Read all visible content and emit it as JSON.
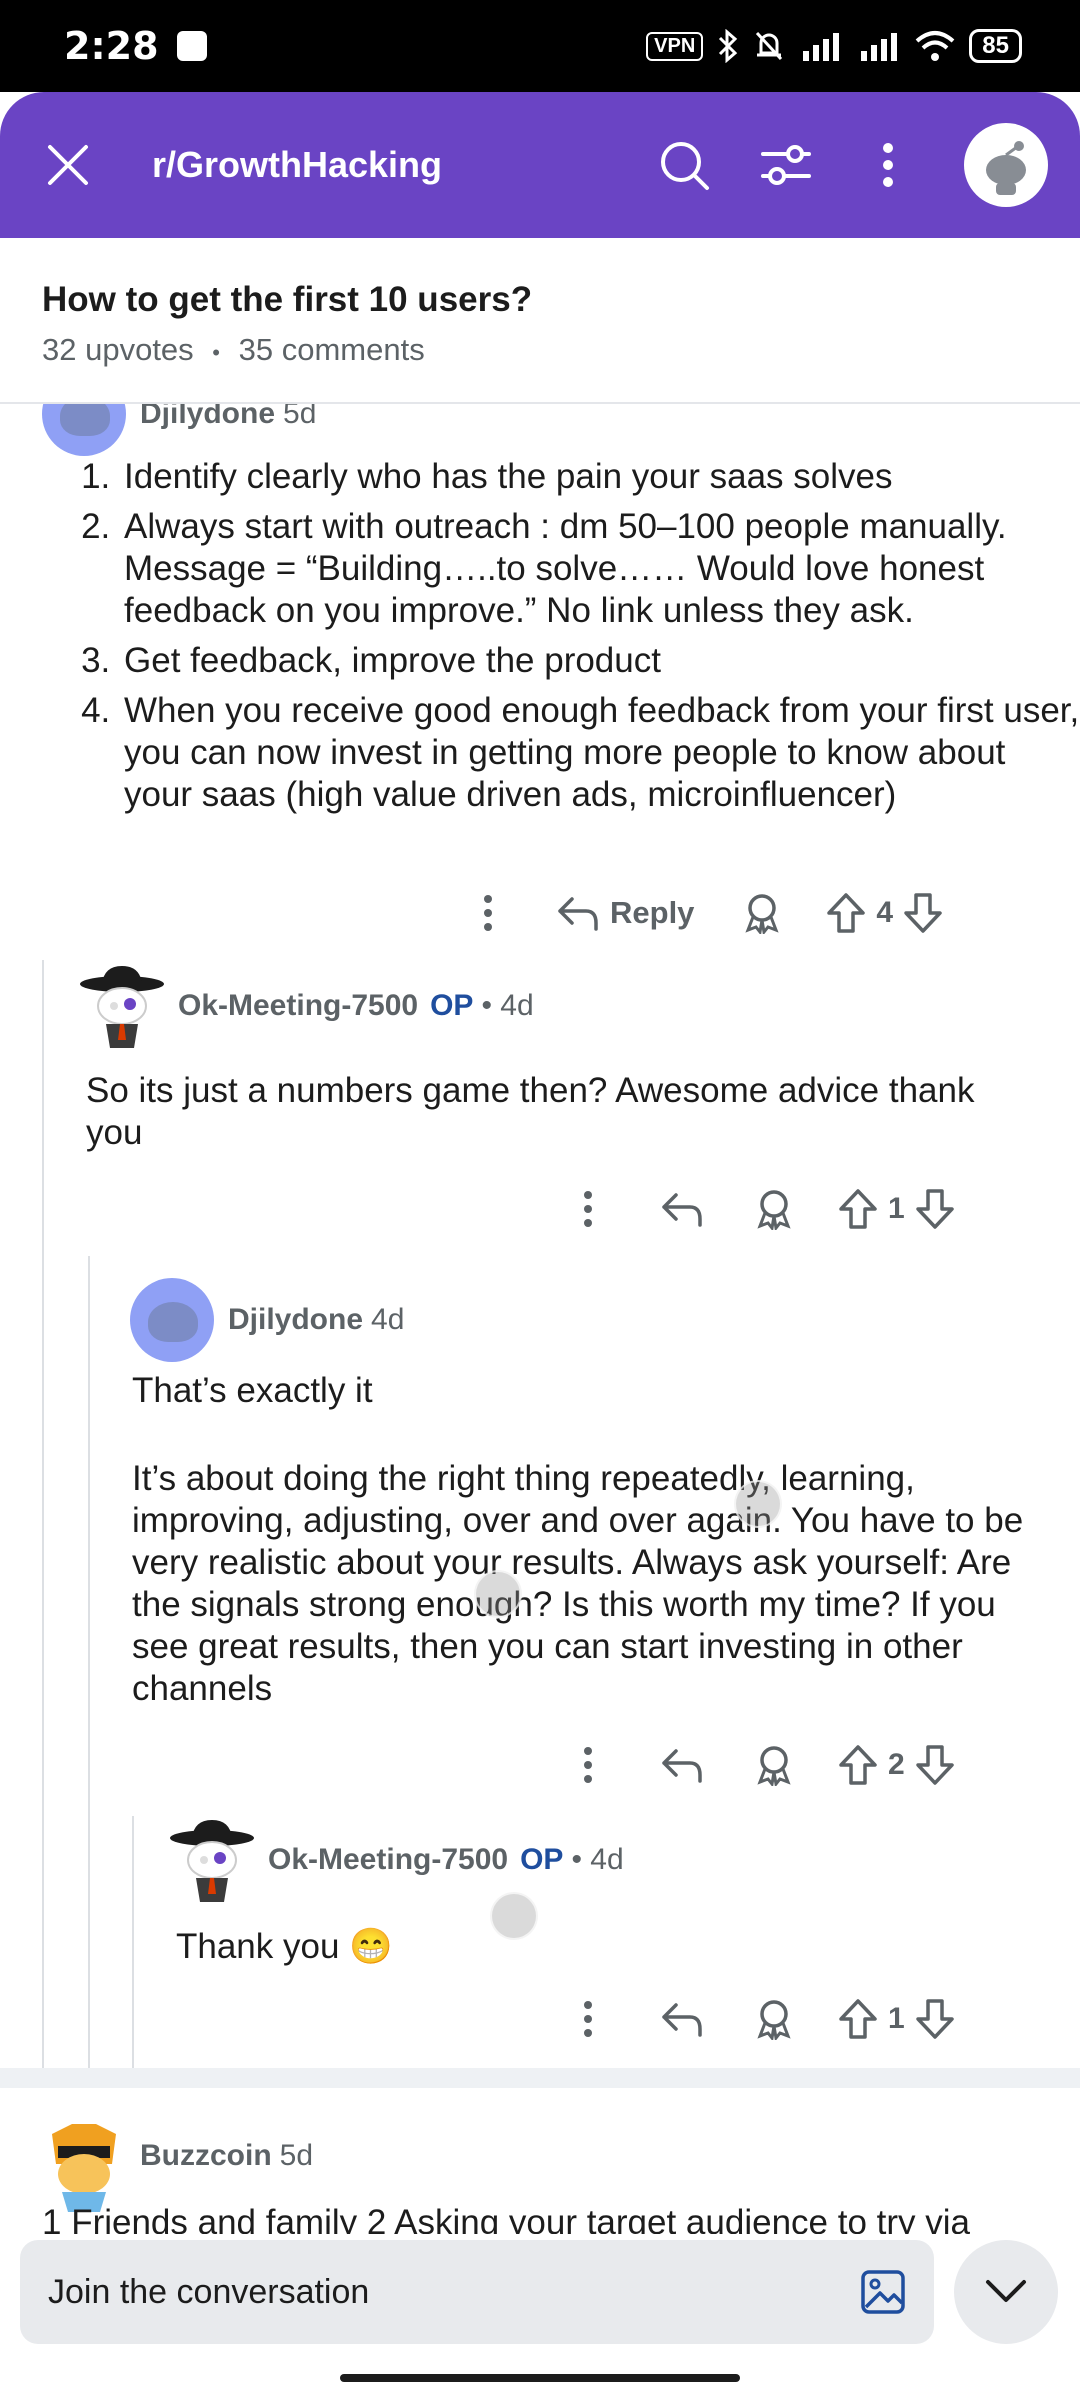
{
  "status_bar": {
    "time": "2:28",
    "vpn": "VPN",
    "battery": "85"
  },
  "top_bar": {
    "subreddit": "r/GrowthHacking"
  },
  "post": {
    "title": "How to get the first 10 users?",
    "upvotes": "32 upvotes",
    "separator": "•",
    "comments": "35 comments"
  },
  "comments": [
    {
      "author": "Djilydone",
      "age": "5d",
      "list": [
        "Identify clearly who has the pain your saas solves",
        "Always start with outreach : dm 50–100 people manually. Message = “Building…..to solve…… Would love honest feedback on you improve.” No link unless they ask.",
        "Get feedback, improve the product",
        "When you receive good enough feedback from your first user, you can now invest in getting more people to know about your saas (high value driven ads, microinfluencer)"
      ],
      "reply_label": "Reply",
      "votes": "4"
    },
    {
      "author": "Ok-Meeting-7500",
      "op": "OP",
      "age": "• 4d",
      "text": "So its just a numbers game then? Awesome advice thank you",
      "votes": "1"
    },
    {
      "author": "Djilydone",
      "age": "4d",
      "text1": "That’s exactly it",
      "text2": "It’s about doing the right thing repeatedly, learning, improving, adjusting, over and over again. You have to be very realistic about your results. Always ask yourself: Are the signals strong enough? Is this worth my time? If you see great results, then you can start investing in other channels",
      "votes": "2"
    },
    {
      "author": "Ok-Meeting-7500",
      "op": "OP",
      "age": "• 4d",
      "text": "Thank you 😁",
      "votes": "1"
    },
    {
      "author": "Buzzcoin",
      "age": "5d",
      "text": "1 Friends and family 2 Asking your target audience to try via"
    }
  ],
  "bottom": {
    "placeholder": "Join the conversation"
  },
  "colors": {
    "header": "#6a44c4",
    "op": "#1f4e9e"
  }
}
